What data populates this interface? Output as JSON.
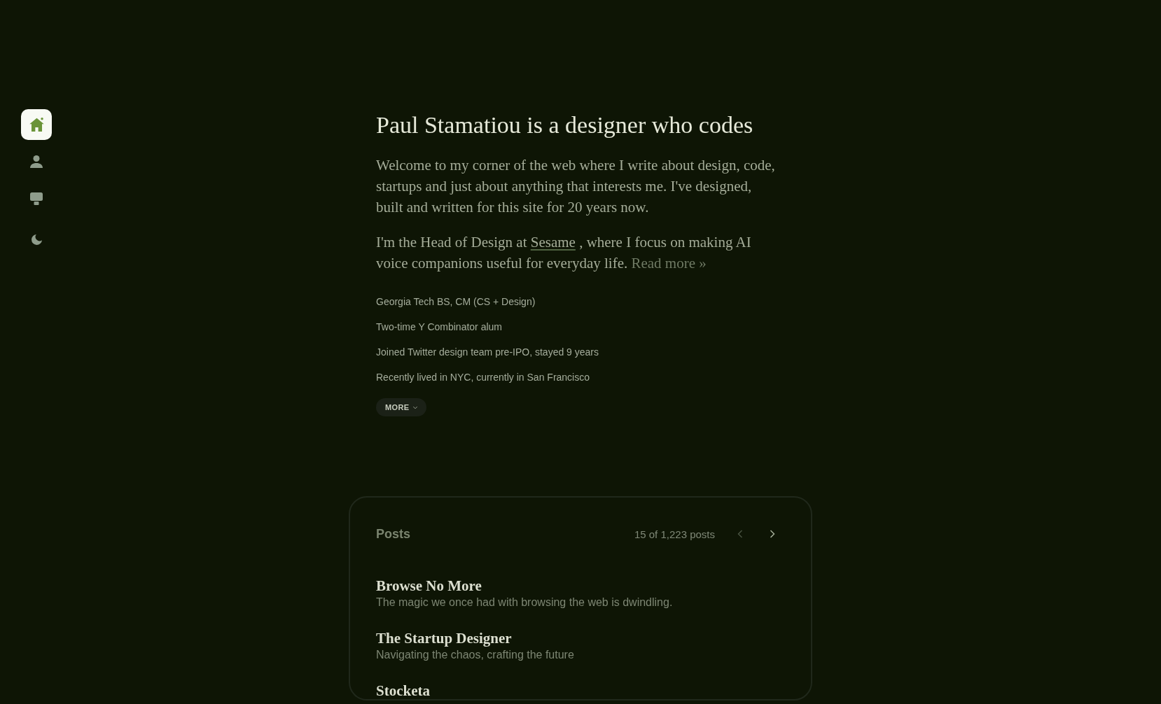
{
  "sidebar": {
    "nav_items": [
      {
        "selected": true
      },
      {
        "selected": false
      },
      {
        "selected": false
      }
    ]
  },
  "intro": {
    "heading": "Paul Stamatiou is a designer who codes",
    "paragraphs": [
      {
        "segments": [
          {
            "kind": "text",
            "text": "Welcome to my corner of the web where I write about design, code, startups and just about anything that interests me. I've designed, built and written for this site for 20 years now."
          }
        ]
      },
      {
        "segments": [
          {
            "kind": "text",
            "text": "I'm the Head of Design at"
          },
          {
            "kind": "link",
            "text": "Sesame"
          },
          {
            "kind": "text",
            "text": ", where I focus on making AI voice companions useful for everyday life."
          },
          {
            "kind": "more_link",
            "text": "Read more »"
          }
        ]
      }
    ],
    "facts": [
      "Georgia Tech BS, CM (CS + Design)",
      "Two-time Y Combinator alum",
      "Joined Twitter design team pre-IPO, stayed 9 years",
      "Recently lived in NYC, currently in San Francisco"
    ],
    "more_button": {
      "label": "MORE",
      "expanded": false
    }
  },
  "posts": {
    "title": "Posts",
    "count": "15 of 1,223 posts",
    "previous": {
      "disabled": true
    },
    "next": {
      "disabled": false
    },
    "items": [
      {
        "title": "Browse No More",
        "description": "The magic we once had with browsing the web is dwindling."
      },
      {
        "title": "The Startup Designer",
        "description": "Navigating the chaos, crafting the future"
      },
      {
        "title": "Stocketa"
      }
    ]
  }
}
